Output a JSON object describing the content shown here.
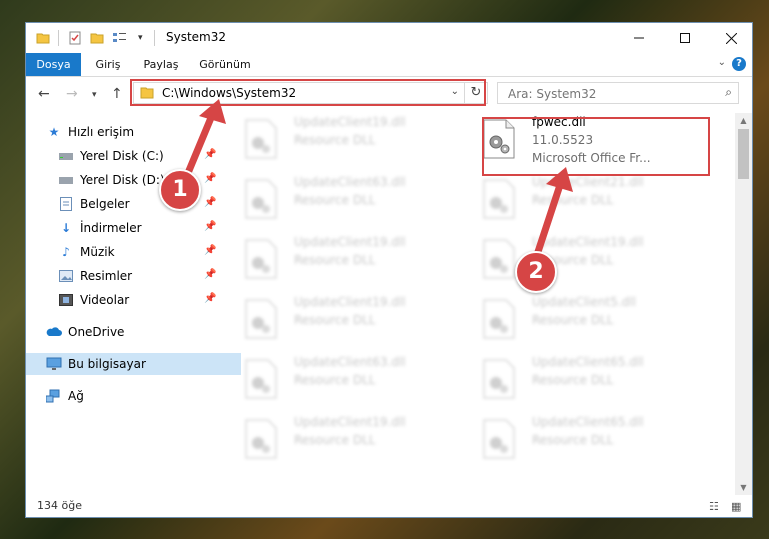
{
  "window": {
    "title": "System32"
  },
  "ribbon": {
    "tabs": [
      "Dosya",
      "Giriş",
      "Paylaş",
      "Görünüm"
    ],
    "help": "?"
  },
  "address": {
    "path": "C:\\Windows\\System32"
  },
  "search": {
    "placeholder": "Ara: System32"
  },
  "nav": {
    "items": [
      {
        "label": "Hızlı erişim",
        "icon": "star-icon"
      },
      {
        "label": "Yerel Disk (C:)",
        "icon": "drive-icon",
        "pinned": true
      },
      {
        "label": "Yerel Disk (D:)",
        "icon": "drive-icon",
        "pinned": true
      },
      {
        "label": "Belgeler",
        "icon": "documents-icon",
        "pinned": true
      },
      {
        "label": "İndirmeler",
        "icon": "download-icon",
        "pinned": true
      },
      {
        "label": "Müzik",
        "icon": "music-icon",
        "pinned": true
      },
      {
        "label": "Resimler",
        "icon": "pictures-icon",
        "pinned": true
      },
      {
        "label": "Videolar",
        "icon": "videos-icon",
        "pinned": true
      },
      {
        "label": "OneDrive",
        "icon": "cloud-icon"
      },
      {
        "label": "Bu bilgisayar",
        "icon": "computer-icon",
        "selected": true
      },
      {
        "label": "Ağ",
        "icon": "network-icon"
      }
    ]
  },
  "files": {
    "highlighted": {
      "name": "fpwec.dll",
      "version": "11.0.5523",
      "description": "Microsoft Office Fr..."
    },
    "blurred": [
      {
        "name": "UpdateClient19.dll",
        "type": "Resource DLL"
      },
      {
        "name": "UpdateClient63.dll",
        "type": "Resource DLL"
      },
      {
        "name": "UpdateClient21.dll",
        "type": "Resource DLL"
      },
      {
        "name": "UpdateClient19.dll",
        "type": "Resource DLL"
      },
      {
        "name": "UpdateClient19.dll",
        "type": "Resource DLL"
      },
      {
        "name": "UpdateClient19.dll",
        "type": "Resource DLL"
      },
      {
        "name": "UpdateClient5.dll",
        "type": "Resource DLL"
      },
      {
        "name": "UpdateClient63.dll",
        "type": "Resource DLL"
      },
      {
        "name": "UpdateClient65.dll",
        "type": "Resource DLL"
      },
      {
        "name": "UpdateClient19.dll",
        "type": "Resource DLL"
      },
      {
        "name": "UpdateClient65.dll",
        "type": "Resource DLL"
      }
    ]
  },
  "status": {
    "count": "134 öğe"
  },
  "annotations": {
    "badge1": "1",
    "badge2": "2"
  },
  "colors": {
    "accent": "#1979ca",
    "highlight": "#d64545",
    "selected": "#cce4f7"
  }
}
